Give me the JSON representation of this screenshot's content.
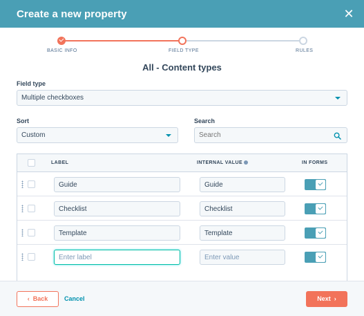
{
  "header": {
    "title": "Create a new property",
    "close_icon": "close-icon"
  },
  "stepper": {
    "steps": [
      {
        "label": "BASIC INFO",
        "state": "done"
      },
      {
        "label": "FIELD TYPE",
        "state": "active"
      },
      {
        "label": "RULES",
        "state": "pending"
      }
    ]
  },
  "section_title": "All - Content types",
  "field_type": {
    "label": "Field type",
    "value": "Multiple checkboxes"
  },
  "sort": {
    "label": "Sort",
    "value": "Custom"
  },
  "search": {
    "label": "Search",
    "placeholder": "Search"
  },
  "table": {
    "headers": {
      "label": "LABEL",
      "internal_value": "INTERNAL VALUE",
      "in_forms": "IN FORMS"
    },
    "rows": [
      {
        "label": "Guide",
        "value": "Guide",
        "in_forms": true
      },
      {
        "label": "Checklist",
        "value": "Checklist",
        "in_forms": true
      },
      {
        "label": "Template",
        "value": "Template",
        "in_forms": true
      }
    ],
    "new_row": {
      "label_placeholder": "Enter label",
      "value_placeholder": "Enter value",
      "in_forms": true
    }
  },
  "footer": {
    "back_label": "Back",
    "cancel_label": "Cancel",
    "next_label": "Next"
  },
  "colors": {
    "header_bg": "#4a9fb5",
    "accent": "#f2735a",
    "link": "#0091ae",
    "toggle": "#4a9fb5"
  }
}
